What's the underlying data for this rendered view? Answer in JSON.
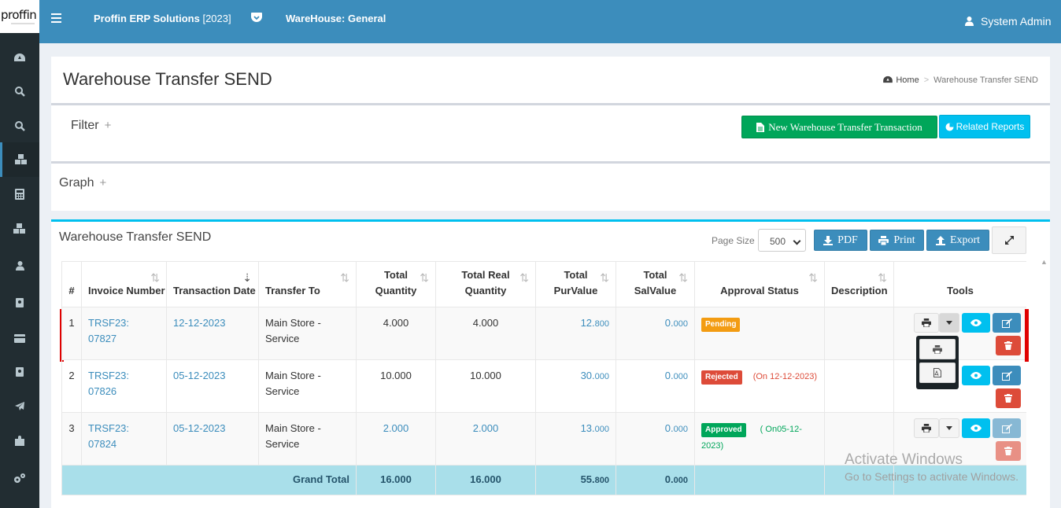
{
  "header": {
    "logo_text": "proffin",
    "app_name": "Proffin ERP Solutions",
    "app_year": "[2023]",
    "warehouse": "WareHouse: General",
    "user": "System Admin"
  },
  "sidebar": {
    "icons": [
      "dashboard-icon",
      "search-icon",
      "search-icon",
      "cubes-icon",
      "calculator-icon",
      "cubes-icon",
      "user-icon",
      "id-card-icon",
      "credit-card-icon",
      "id-card-icon",
      "plane-icon",
      "puzzle-icon",
      "cogs-icon"
    ],
    "active_index": 3
  },
  "page": {
    "title": "Warehouse Transfer SEND",
    "breadcrumb_home": "Home",
    "breadcrumb_sep": ">",
    "breadcrumb_current": "Warehouse Transfer SEND"
  },
  "filter": {
    "label": "Filter",
    "plus": "+"
  },
  "actions": {
    "new_transaction": "New Warehouse Transfer Transaction",
    "related_reports": "Related Reports"
  },
  "graph": {
    "label": "Graph",
    "plus": "+"
  },
  "table_panel": {
    "title": "Warehouse Transfer SEND",
    "page_size_label": "Page Size",
    "page_size_value": "500",
    "pdf_label": "PDF",
    "print_label": "Print",
    "export_label": "Export"
  },
  "table": {
    "headers": {
      "num": "#",
      "invoice": "Invoice Number",
      "date": "Transaction Date",
      "transfer_to": "Transfer To",
      "total_qty": "Total Quantity",
      "total_real_qty": "Total Real Quantity",
      "pur_value": "Total PurValue",
      "sal_value": "Total SalValue",
      "approval": "Approval Status",
      "description": "Description",
      "tools": "Tools"
    },
    "rows": [
      {
        "num": "1",
        "invoice": "TRSF23: 07827",
        "date": "12-12-2023",
        "transfer_to": "Main Store - Service",
        "total_qty": "4.000",
        "total_real_qty": "4.000",
        "pur_main": "12.",
        "pur_dec": "800",
        "sal_main": "0.",
        "sal_dec": "000",
        "status": "Pending",
        "note": ""
      },
      {
        "num": "2",
        "invoice": "TRSF23: 07826",
        "date": "05-12-2023",
        "transfer_to": "Main Store - Service",
        "total_qty": "10.000",
        "total_real_qty": "10.000",
        "pur_main": "30.",
        "pur_dec": "000",
        "sal_main": "0.",
        "sal_dec": "000",
        "status": "Rejected",
        "note": "(On 12-12-2023)"
      },
      {
        "num": "3",
        "invoice": "TRSF23: 07824",
        "date": "05-12-2023",
        "transfer_to": "Main Store - Service",
        "total_qty": "2.000",
        "total_real_qty": "2.000",
        "pur_main": "13.",
        "pur_dec": "000",
        "sal_main": "0.",
        "sal_dec": "000",
        "status": "Approved",
        "note": "( On05-12-2023)"
      }
    ],
    "total": {
      "label": "Grand Total",
      "qty": "16.000",
      "real_qty": "16.000",
      "pur_main": "55.",
      "pur_dec": "800",
      "sal_main": "0.",
      "sal_dec": "000"
    }
  },
  "watermark": {
    "line1": "Activate Windows",
    "line2": "Go to Settings to activate Windows."
  },
  "colors": {
    "header": "#3c8dbc",
    "sidebar": "#222d32",
    "success": "#00a65a",
    "info": "#00c0ef",
    "danger": "#dd4b39",
    "warning": "#f39c12"
  }
}
